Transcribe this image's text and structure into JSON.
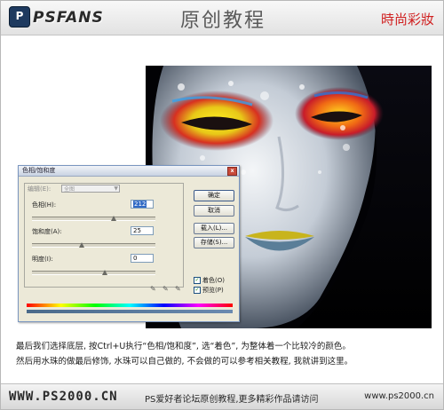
{
  "header": {
    "logo": "PSFANS",
    "title": "原创教程",
    "tag": "時尚彩妝"
  },
  "dialog": {
    "title": "色相/饱和度",
    "edit_label": "编辑(E):",
    "edit_value": "全图",
    "hue_label": "色相(H):",
    "hue_value": "212",
    "saturation_label": "饱和度(A):",
    "saturation_value": "25",
    "lightness_label": "明度(I):",
    "lightness_value": "0",
    "ok_label": "确定",
    "cancel_label": "取消",
    "load_label": "载入(L)...",
    "save_label": "存储(S)...",
    "colorize_label": "着色(O)",
    "preview_label": "预览(P)",
    "colorize_checked": true,
    "preview_checked": true
  },
  "caption": {
    "line1": "最后我们选择底层, 按Ctrl+U执行“色相/饱和度”, 选“着色”, 为整体着一个比较冷的颜色。",
    "line2": "然后用水珠的做最后修饰, 水珠可以自己做的, 不会做的可以参考相关教程, 我就讲到这里。"
  },
  "footer": {
    "site_left": "WWW.PS2000.CN",
    "middle": "PS爱好者论坛原创教程,更多精彩作品请访问",
    "site_right": "www.ps2000.cn"
  }
}
